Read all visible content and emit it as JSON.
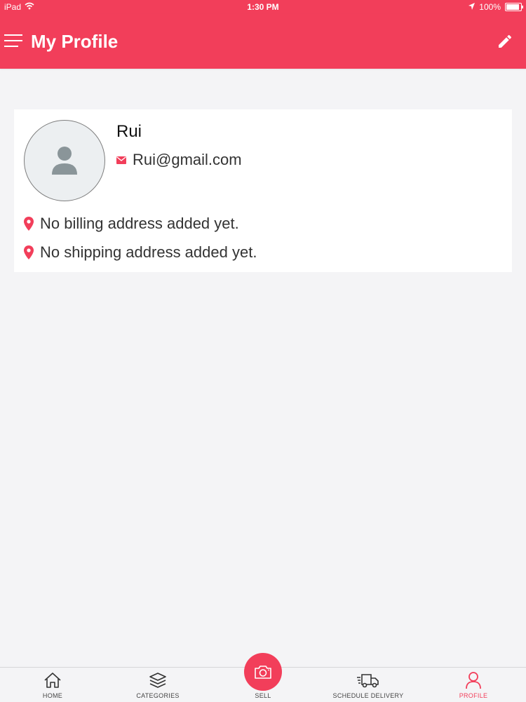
{
  "status_bar": {
    "device": "iPad",
    "time": "1:30 PM",
    "battery": "100%",
    "battery_level": 1.0
  },
  "header": {
    "title": "My Profile"
  },
  "profile": {
    "name": "Rui",
    "email": "Rui@gmail.com",
    "billing_address": "No billing address added yet.",
    "shipping_address": "No shipping address added yet."
  },
  "tabs": [
    {
      "label": "HOME",
      "icon": "home-icon"
    },
    {
      "label": "CATEGORIES",
      "icon": "layers-icon"
    },
    {
      "label": "SELL",
      "icon": "camera-icon"
    },
    {
      "label": "SCHEDULE DELIVERY",
      "icon": "delivery-truck-icon"
    },
    {
      "label": "PROFILE",
      "icon": "user-icon",
      "active": true
    }
  ],
  "colors": {
    "accent": "#f23e5a",
    "background": "#f4f4f6",
    "card": "#ffffff",
    "avatar_bg": "#eceff1",
    "avatar_figure": "#8a9599"
  }
}
